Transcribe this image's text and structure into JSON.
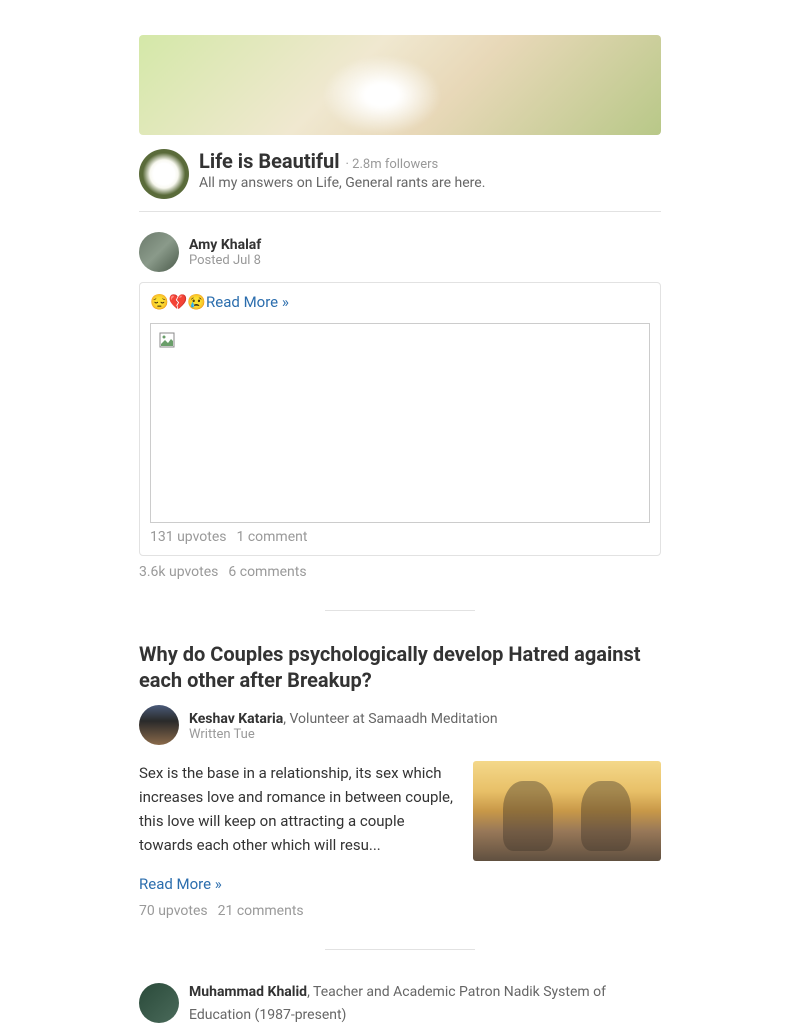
{
  "space": {
    "name": "Life is Beautiful",
    "followers_text": "· 2.8m followers",
    "description": "All my answers on Life, General rants are here."
  },
  "posts": [
    {
      "author": {
        "name": "Amy Khalaf",
        "meta": "Posted Jul 8"
      },
      "embed": {
        "emojis": "😔💔😢",
        "readmore": "Read More »",
        "stats": {
          "upvotes": "131 upvotes",
          "comments": "1 comment"
        }
      },
      "outer_stats": {
        "upvotes": "3.6k upvotes",
        "comments": "6 comments"
      }
    },
    {
      "title": "Why do Couples psychologically develop Hatred against each other after Breakup?",
      "author": {
        "name": "Keshav Kataria",
        "credential": ", Volunteer at Samaadh Meditation",
        "meta": "Written Tue"
      },
      "excerpt": "Sex is the base in a relationship, its sex which increases love and romance in between couple, this love will keep on attracting a couple towards each other which will resu...",
      "readmore": "Read More »",
      "stats": {
        "upvotes": "70 upvotes",
        "comments": "21 comments"
      }
    },
    {
      "author": {
        "name": "Muhammad Khalid",
        "credential": ", Teacher and Academic Patron Nadik System of Education (1987-present)"
      }
    }
  ]
}
